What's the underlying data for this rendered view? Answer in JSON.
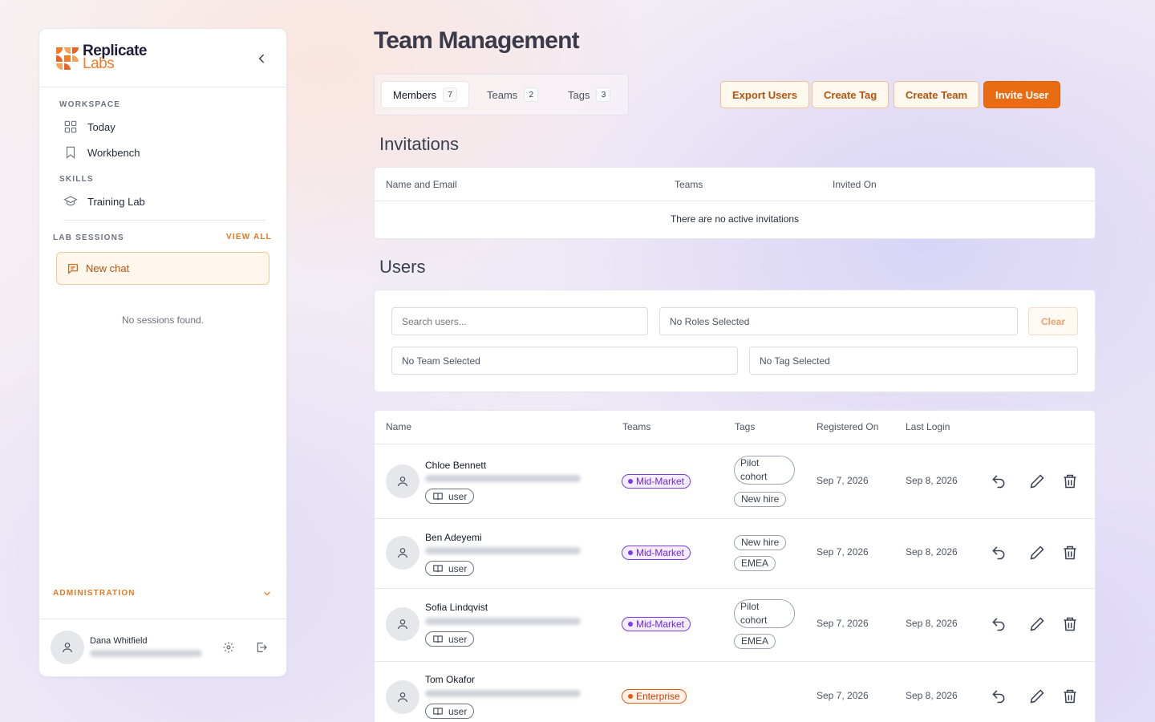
{
  "sidebar": {
    "brand_line1": "Replicate",
    "brand_line2": "Labs",
    "workspace_label": "WORKSPACE",
    "workspace_items": [
      {
        "label": "Today",
        "icon": "grid-icon"
      },
      {
        "label": "Workbench",
        "icon": "bookmark-icon"
      }
    ],
    "skills_label": "SKILLS",
    "skills_items": [
      {
        "label": "Training Lab",
        "icon": "graduation-cap-icon"
      }
    ],
    "lab_sessions_label": "LAB SESSIONS",
    "view_all": "VIEW ALL",
    "new_chat": "New chat",
    "no_sessions": "No sessions found.",
    "administration": "ADMINISTRATION",
    "user_name": "Dana Whitfield"
  },
  "page": {
    "title": "Team Management",
    "tabs": [
      {
        "label": "Members",
        "count": "7",
        "active": true
      },
      {
        "label": "Teams",
        "count": "2",
        "active": false
      },
      {
        "label": "Tags",
        "count": "3",
        "active": false
      }
    ],
    "actions": {
      "export_users": "Export Users",
      "create_tag": "Create Tag",
      "create_team": "Create Team",
      "invite_user": "Invite User"
    }
  },
  "invitations": {
    "heading": "Invitations",
    "columns": [
      "Name and Email",
      "Teams",
      "Invited On"
    ],
    "empty": "There are no active invitations"
  },
  "users": {
    "heading": "Users",
    "filters": {
      "search_placeholder": "Search users...",
      "roles": "No Roles Selected",
      "clear": "Clear",
      "team": "No Team Selected",
      "tag": "No Tag Selected"
    },
    "columns": [
      "Name",
      "Teams",
      "Tags",
      "Registered On",
      "Last Login"
    ],
    "rows": [
      {
        "name": "Chloe Bennett",
        "role": "user",
        "team": "Mid-Market",
        "tags": [
          "Pilot cohort",
          "New hire"
        ],
        "registered": "Sep 7, 2026",
        "last_login": "Sep 8, 2026"
      },
      {
        "name": "Ben Adeyemi",
        "role": "user",
        "team": "Mid-Market",
        "tags": [
          "New hire",
          "EMEA"
        ],
        "registered": "Sep 7, 2026",
        "last_login": "Sep 8, 2026"
      },
      {
        "name": "Sofia Lindqvist",
        "role": "user",
        "team": "Mid-Market",
        "tags": [
          "Pilot cohort",
          "EMEA"
        ],
        "registered": "Sep 7, 2026",
        "last_login": "Sep 8, 2026"
      },
      {
        "name": "Tom Okafor",
        "role": "user",
        "team": "Enterprise",
        "tags": [],
        "registered": "Sep 7, 2026",
        "last_login": "Sep 8, 2026"
      }
    ]
  },
  "colors": {
    "accent": "#ea6c12",
    "mid_market": "#7c3aed",
    "enterprise": "#ea580c"
  }
}
